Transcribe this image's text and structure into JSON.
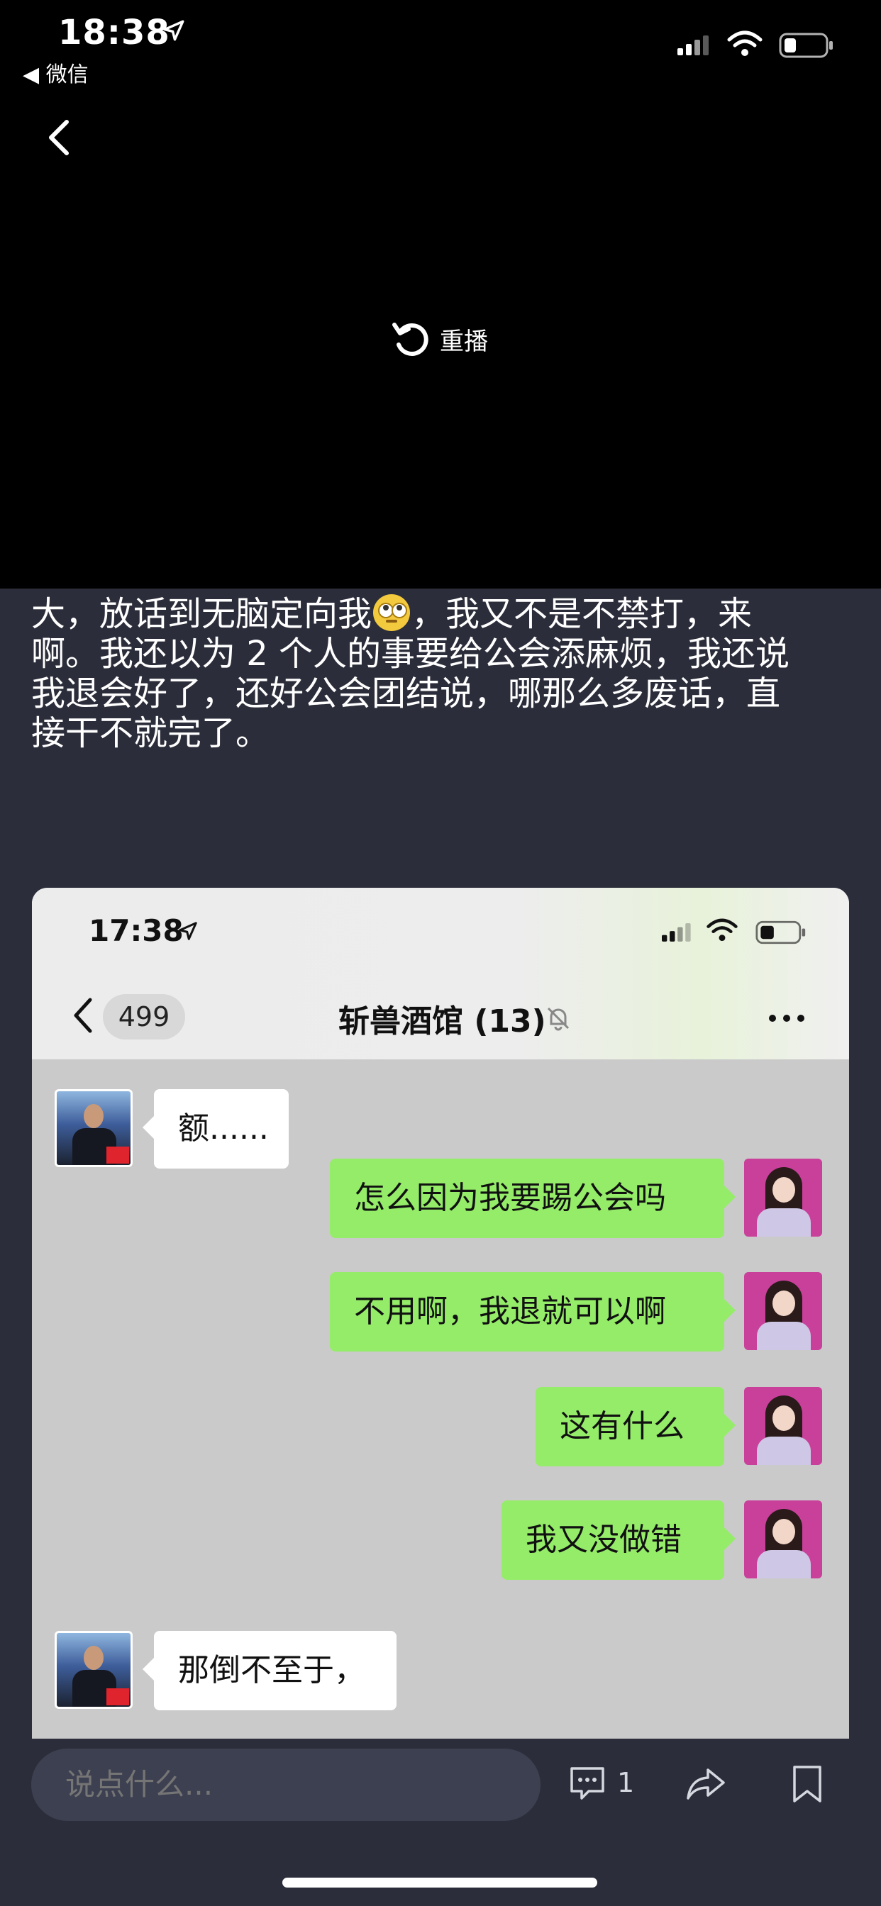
{
  "status_bar": {
    "time": "18:38",
    "back_app": "◀ 微信"
  },
  "video": {
    "replay_label": "重播"
  },
  "article": {
    "lines": [
      "大，放话到无脑定向我",
      "，我又不是不禁打，来",
      "啊。我还以为 2 个人的事要给公会添麻烦，我还说",
      "我退会好了，还好公会团结说，哪那么多废话，直",
      "接干不就完了。"
    ]
  },
  "screenshot": {
    "time": "17:38",
    "unread_count": "499",
    "group_title": "斩兽酒馆 (13)",
    "messages": [
      {
        "side": "left",
        "text": "额......"
      },
      {
        "side": "right",
        "text": "怎么因为我要踢公会吗"
      },
      {
        "side": "right",
        "text": "不用啊，我退就可以啊"
      },
      {
        "side": "right",
        "text": "这有什么"
      },
      {
        "side": "right",
        "text": "我又没做错"
      },
      {
        "side": "left",
        "text": "那倒不至于，"
      }
    ]
  },
  "bottom_bar": {
    "comment_placeholder": "说点什么...",
    "comment_count": "1"
  },
  "colors": {
    "page_bg": "#2b2d3a",
    "bubble_green": "#95ec69",
    "bubble_white": "#ffffff"
  },
  "icons": [
    "location-arrow-icon",
    "signal-icon",
    "wifi-icon",
    "battery-icon",
    "back-chevron-icon",
    "replay-icon",
    "eye-roll-emoji-icon",
    "muted-bell-icon",
    "more-dots-icon",
    "comment-icon",
    "share-icon",
    "bookmark-icon"
  ]
}
